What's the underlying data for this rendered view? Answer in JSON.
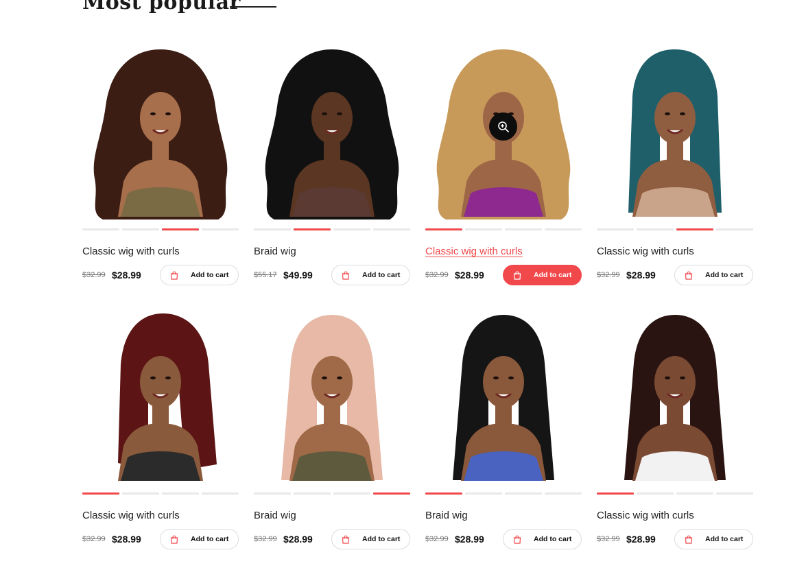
{
  "section": {
    "title": "Most popular"
  },
  "products": [
    {
      "name": "Classic wig with curls",
      "old_price": "$32.99",
      "new_price": "$28.99",
      "cart_label": "Add to cart",
      "active_dot": 2,
      "hair": "#3b1d14",
      "skin": "#a86f4c",
      "top": "#7b6b45",
      "style": "curly"
    },
    {
      "name": "Braid wig",
      "old_price": "$55.17",
      "new_price": "$49.99",
      "cart_label": "Add to cart",
      "active_dot": 1,
      "hair": "#111111",
      "skin": "#5b3623",
      "top": "#5a3a33",
      "style": "curly"
    },
    {
      "name": "Classic wig with curls",
      "old_price": "$32.99",
      "new_price": "$28.99",
      "cart_label": "Add to cart",
      "active_dot": 0,
      "hair": "#c89a5a",
      "skin": "#9d6646",
      "top": "#8e2a8f",
      "style": "curly",
      "hovered": true
    },
    {
      "name": "Classic wig with curls",
      "old_price": "$32.99",
      "new_price": "$28.99",
      "cart_label": "Add to cart",
      "active_dot": 2,
      "hair": "#1e5f6a",
      "skin": "#8f5d40",
      "top": "#c9a48a",
      "style": "straight"
    },
    {
      "name": "Classic wig with curls",
      "old_price": "$32.99",
      "new_price": "$28.99",
      "cart_label": "Add to cart",
      "active_dot": 0,
      "hair": "#5c1414",
      "skin": "#8a5a3c",
      "top": "#2b2b2b",
      "style": "bob"
    },
    {
      "name": "Braid wig",
      "old_price": "$32.99",
      "new_price": "$28.99",
      "cart_label": "Add to cart",
      "active_dot": 3,
      "hair": "#e7b9a6",
      "skin": "#a06a48",
      "top": "#5e5a3e",
      "style": "long"
    },
    {
      "name": "Braid wig",
      "old_price": "$32.99",
      "new_price": "$28.99",
      "cart_label": "Add to cart",
      "active_dot": 0,
      "hair": "#151515",
      "skin": "#8a583b",
      "top": "#4a63c0",
      "style": "long"
    },
    {
      "name": "Classic wig with curls",
      "old_price": "$32.99",
      "new_price": "$28.99",
      "cart_label": "Add to cart",
      "active_dot": 0,
      "hair": "#2a1412",
      "skin": "#7a4a33",
      "top": "#f2f2f2",
      "style": "long"
    }
  ],
  "icons": {
    "zoom": "zoom-in-icon",
    "cart": "shopping-bag-icon"
  },
  "colors": {
    "accent": "#f0484b",
    "text": "#111111"
  }
}
